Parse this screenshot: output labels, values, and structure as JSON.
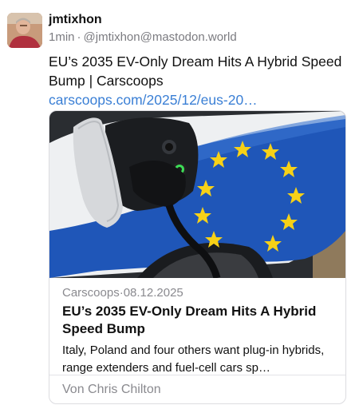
{
  "post": {
    "author": {
      "display_name": "jmtixhon",
      "time": "1min",
      "separator": "·",
      "handle": "@jmtixhon@mastodon.world",
      "avatar_icon": "user-avatar"
    },
    "text": "EU’s 2035 EV-Only Dream Hits A Hybrid Speed Bump | Carscoops",
    "link_text": "carscoops.com/2025/12/eus-20…"
  },
  "card": {
    "image_icon": "ev-charging-eu-flag-photo",
    "source": "Carscoops",
    "date": "08.12.2025",
    "source_separator": "·",
    "title": "EU’s 2035 EV-Only Dream Hits A Hybrid Speed Bump",
    "description": "Italy, Poland and four others want plug-in hybrids, range extenders and fuel-cell cars sp…",
    "byline": "Von Chris Chilton"
  },
  "colors": {
    "link": "#3a7fd5",
    "secondary_text": "#7b7b80",
    "eu_blue": "#1f56b8",
    "eu_star": "#f7d117",
    "charge_led": "#3ddc57"
  }
}
